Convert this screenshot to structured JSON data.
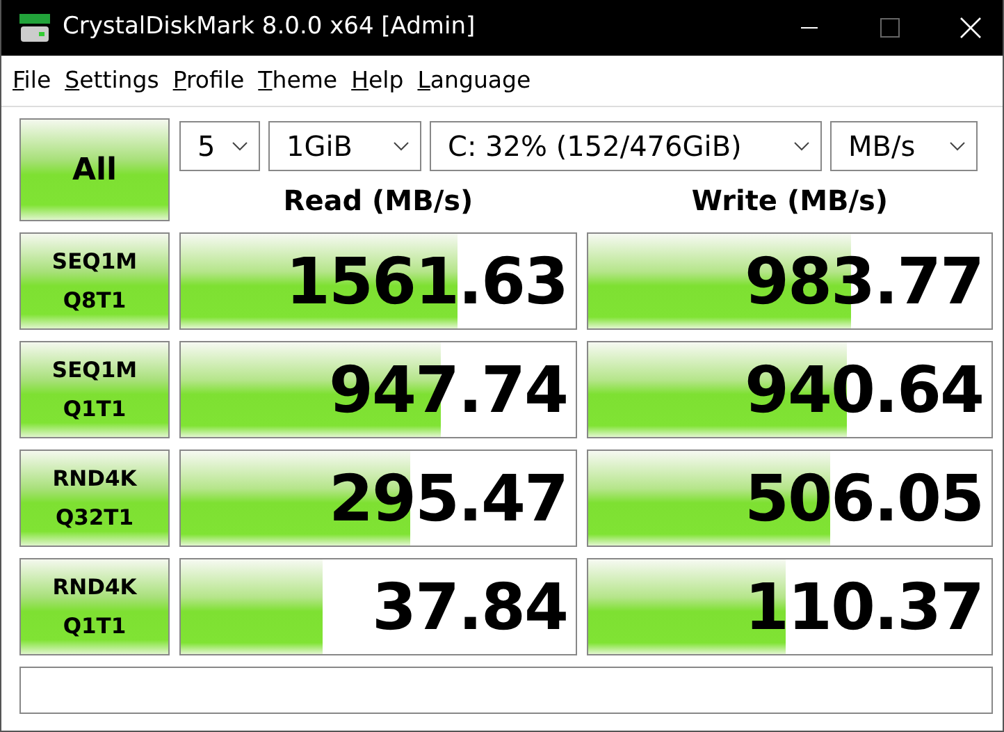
{
  "window": {
    "title": "CrystalDiskMark 8.0.0 x64 [Admin]"
  },
  "menu": [
    "File",
    "Settings",
    "Profile",
    "Theme",
    "Help",
    "Language"
  ],
  "all_button": "All",
  "selectors": [
    {
      "value": "5"
    },
    {
      "value": "1GiB"
    },
    {
      "value": "C: 32% (152/476GiB)"
    },
    {
      "value": "MB/s"
    }
  ],
  "headers": {
    "read": "Read (MB/s)",
    "write": "Write (MB/s)"
  },
  "tests": [
    {
      "label": [
        "SEQ1M",
        "Q8T1"
      ],
      "read": {
        "reading": "1561.63",
        "level": 0.7
      },
      "write": {
        "reading": "983.77",
        "level": 0.65
      }
    },
    {
      "label": [
        "SEQ1M",
        "Q1T1"
      ],
      "read": {
        "reading": "947.74",
        "level": 0.66
      },
      "write": {
        "reading": "940.64",
        "level": 0.64
      }
    },
    {
      "label": [
        "RND4K",
        "Q32T1"
      ],
      "read": {
        "reading": "295.47",
        "level": 0.58
      },
      "write": {
        "reading": "506.05",
        "level": 0.6
      }
    },
    {
      "label": [
        "RND4K",
        "Q1T1"
      ],
      "read": {
        "reading": "37.84",
        "level": 0.36
      },
      "write": {
        "reading": "110.37",
        "level": 0.49
      }
    }
  ]
}
